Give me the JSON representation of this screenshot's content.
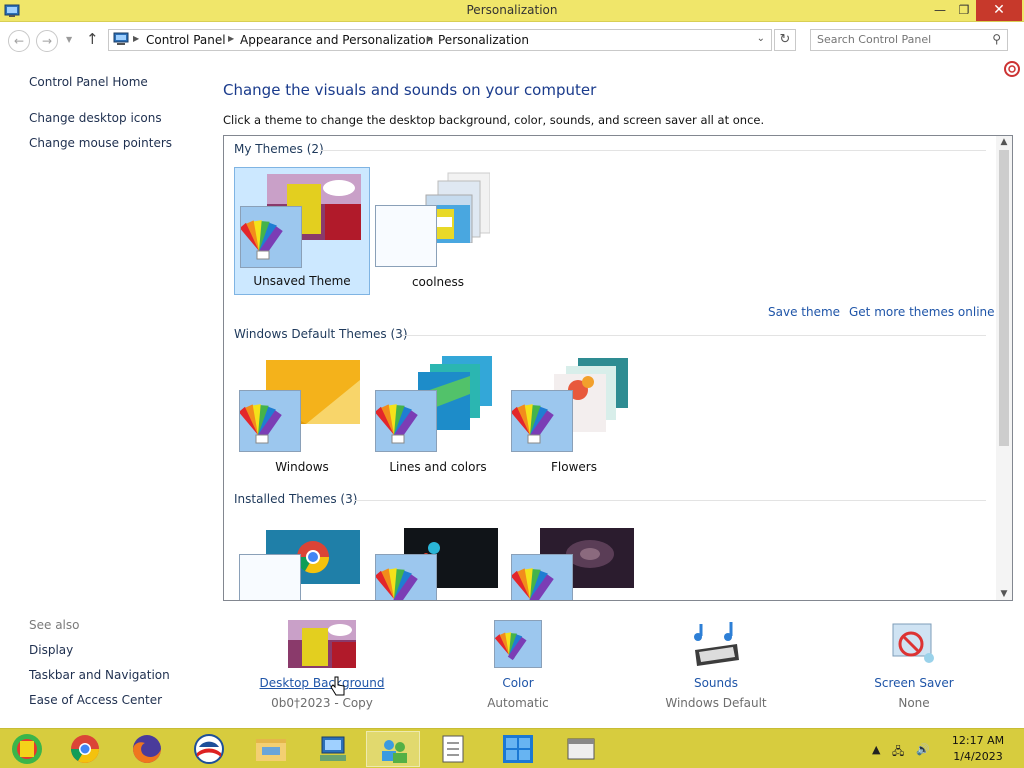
{
  "window": {
    "title": "Personalization"
  },
  "nav": {
    "breadcrumbs": [
      "Control Panel",
      "Appearance and Personalization",
      "Personalization"
    ],
    "search_placeholder": "Search Control Panel"
  },
  "left_pane": {
    "links": [
      "Control Panel Home",
      "Change desktop icons",
      "Change mouse pointers"
    ],
    "see_also_label": "See also",
    "see_also": [
      "Display",
      "Taskbar and Navigation",
      "Ease of Access Center"
    ]
  },
  "main": {
    "heading": "Change the visuals and sounds on your computer",
    "subtext": "Click a theme to change the desktop background, color, sounds, and screen saver all at once.",
    "groups": {
      "my_themes": {
        "label": "My Themes (2)",
        "themes": [
          "Unsaved Theme",
          "coolness"
        ]
      },
      "default_themes": {
        "label": "Windows Default Themes (3)",
        "themes": [
          "Windows",
          "Lines and colors",
          "Flowers"
        ]
      },
      "installed_themes": {
        "label": "Installed Themes (3)"
      }
    },
    "actions": {
      "save_theme": "Save theme",
      "get_more": "Get more themes online"
    }
  },
  "bottom": {
    "desktop_background": {
      "label": "Desktop Background",
      "value": "0b0†2023 - Copy"
    },
    "color": {
      "label": "Color",
      "value": "Automatic"
    },
    "sounds": {
      "label": "Sounds",
      "value": "Windows Default"
    },
    "screen_saver": {
      "label": "Screen Saver",
      "value": "None"
    }
  },
  "taskbar": {
    "time": "12:17 AM",
    "date": "1/4/2023"
  },
  "colors": {
    "titlebar": "#f0e66a",
    "taskbar": "#d7cc3e",
    "heading": "#1a3b8c",
    "link": "#1f55a8",
    "selection": "#cce8ff",
    "close_button": "#c7392b"
  }
}
